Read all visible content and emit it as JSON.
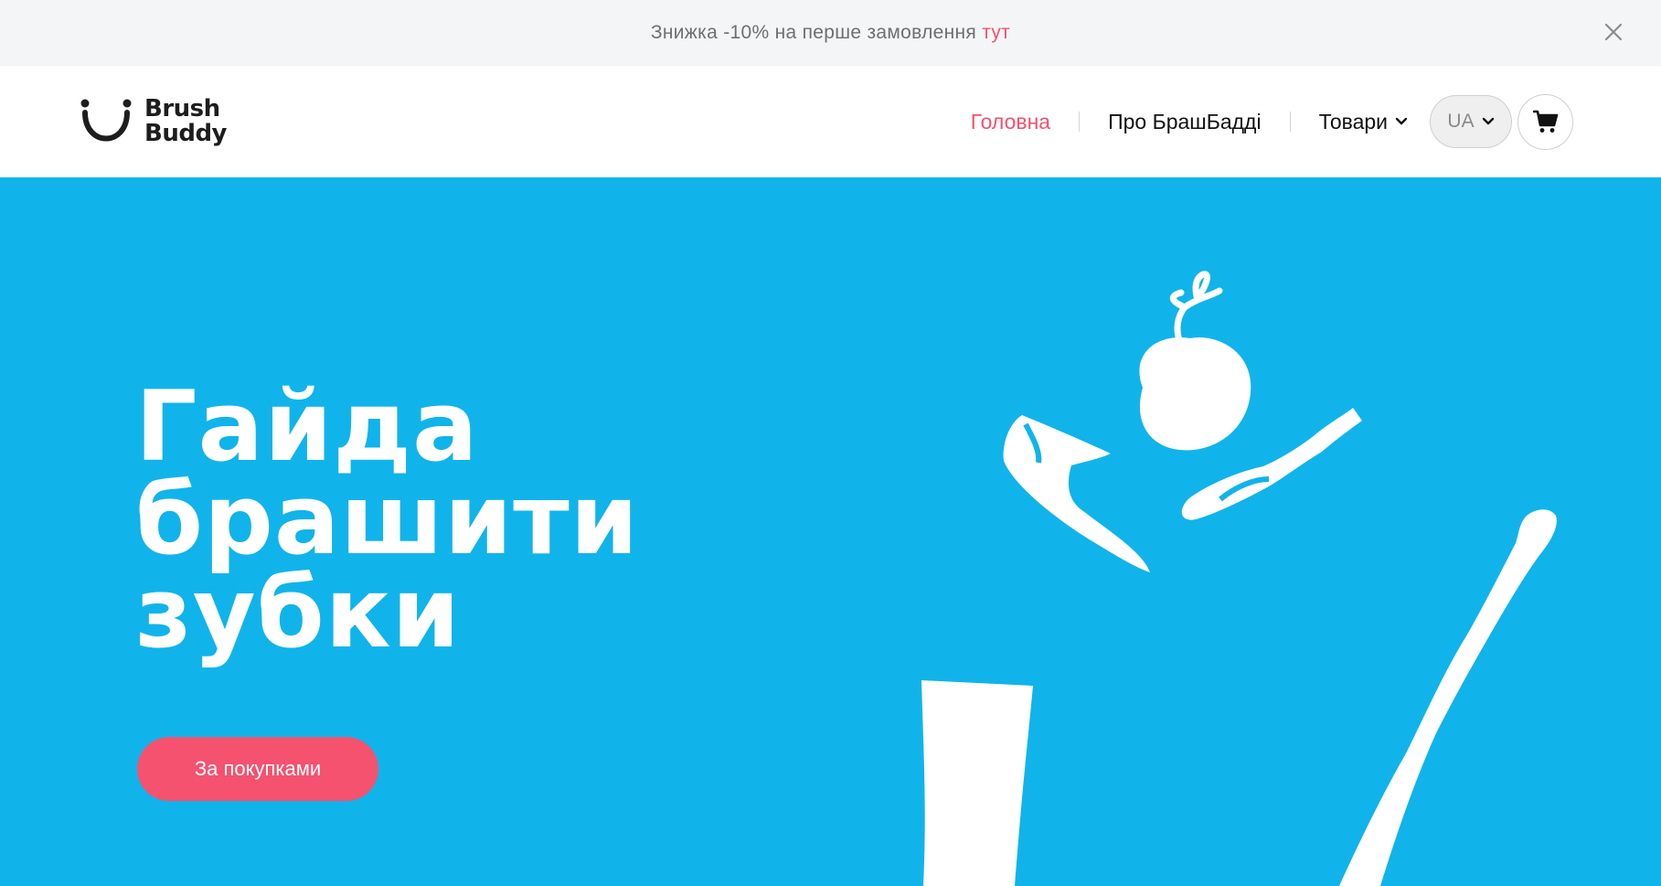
{
  "promo": {
    "text": "Знижка -10% на перше замовлення",
    "link_label": "тут",
    "close_icon": "close-icon"
  },
  "header": {
    "logo_line1": "Brush",
    "logo_line2": "Buddy",
    "nav": [
      {
        "label": "Головна",
        "active": true
      },
      {
        "label": "Про БрашБадді",
        "active": false
      },
      {
        "label": "Товари",
        "active": false,
        "icon": "chevron-down-icon"
      }
    ],
    "language": "UA",
    "cart_icon": "cart-icon"
  },
  "hero": {
    "title_lines": [
      "Гайда",
      "брашити",
      "зубки"
    ],
    "cta_label": "За покупками",
    "illustration_icons": [
      "floss-pick-icon",
      "apple-icon",
      "interdental-brush-icon",
      "toothpaste-tube-icon",
      "toothbrush-icon"
    ]
  },
  "colors": {
    "accent": "#f4526e",
    "hero_background": "#10b4ea",
    "promo_background": "#f4f5f7",
    "text_dark": "#111111"
  }
}
